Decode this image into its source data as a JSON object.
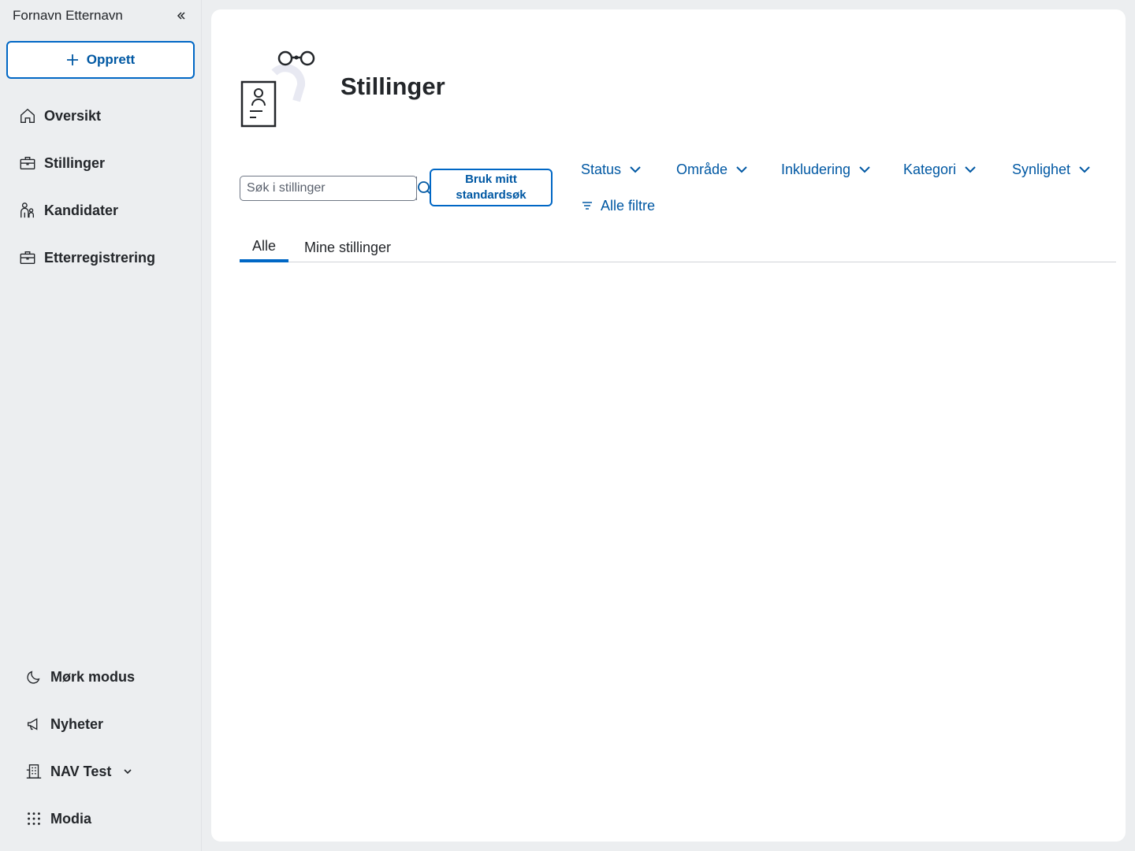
{
  "sidebar": {
    "user_name": "Fornavn Etternavn",
    "create_label": "Opprett",
    "items": [
      {
        "label": "Oversikt",
        "icon": "home-icon"
      },
      {
        "label": "Stillinger",
        "icon": "briefcase-icon"
      },
      {
        "label": "Kandidater",
        "icon": "people-icon"
      },
      {
        "label": "Etterregistrering",
        "icon": "briefcase-icon"
      }
    ],
    "bottom": [
      {
        "label": "Mørk modus",
        "icon": "moon-icon"
      },
      {
        "label": "Nyheter",
        "icon": "megaphone-icon"
      },
      {
        "label": "NAV Test",
        "icon": "building-icon"
      },
      {
        "label": "Modia",
        "icon": "grid-icon"
      }
    ]
  },
  "main": {
    "title": "Stillinger",
    "search_placeholder": "Søk i stillinger",
    "standard_search_label": "Bruk mitt standardsøk",
    "filters": [
      "Status",
      "Område",
      "Inkludering",
      "Kategori",
      "Synlighet"
    ],
    "all_filters_label": "Alle filtre",
    "tabs": [
      "Alle",
      "Mine stillinger"
    ]
  },
  "colors": {
    "accent": "#0067c5",
    "link": "#0058a3",
    "sidebar_bg": "#eceef0",
    "card_bg": "#ffffff"
  }
}
